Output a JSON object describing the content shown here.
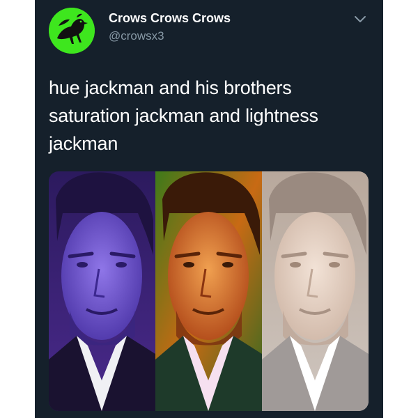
{
  "tweet": {
    "display_name": "Crows Crows Crows",
    "handle": "@crowsx3",
    "text": "hue jackman and his brothers saturation jackman and lightness jackman",
    "avatar_icon": "crow-silhouette-icon",
    "menu_icon": "chevron-down-icon",
    "media": [
      {
        "name": "hue-jackman-photo",
        "tint": "purple"
      },
      {
        "name": "saturation-jackman-photo",
        "tint": "saturated"
      },
      {
        "name": "lightness-jackman-photo",
        "tint": "washed-out"
      }
    ]
  },
  "colors": {
    "background": "#15202b",
    "avatar_bg": "#3ee61e",
    "name": "#ffffff",
    "handle": "#8899a6"
  }
}
